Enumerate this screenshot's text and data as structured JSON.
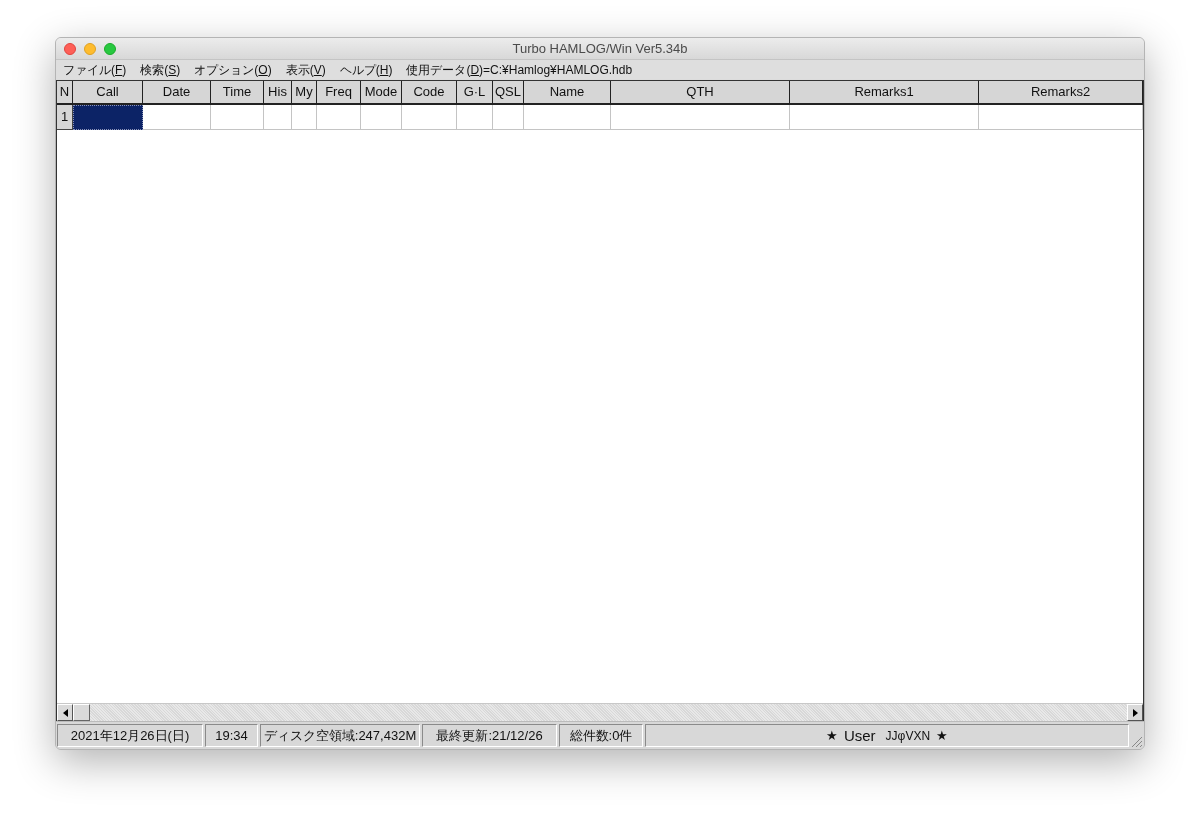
{
  "window": {
    "title": "Turbo HAMLOG/Win Ver5.34b"
  },
  "menu": [
    {
      "label": "ファイル(",
      "key": "F",
      "suffix": ")"
    },
    {
      "label": "検索(",
      "key": "S",
      "suffix": ")"
    },
    {
      "label": "オプション(",
      "key": "O",
      "suffix": ")"
    },
    {
      "label": "表示(",
      "key": "V",
      "suffix": ")"
    },
    {
      "label": "ヘルプ(",
      "key": "H",
      "suffix": ")"
    },
    {
      "label": "使用データ(",
      "key": "D",
      "suffix": ")=C:¥Hamlog¥HAMLOG.hdb"
    }
  ],
  "table": {
    "columns": [
      "N",
      "Call",
      "Date",
      "Time",
      "His",
      "My",
      "Freq",
      "Mode",
      "Code",
      "G·L",
      "QSL",
      "Name",
      "QTH",
      "Remarks1",
      "Remarks2"
    ],
    "rows": [
      {
        "number": "1",
        "cells": [
          {
            "selected": true
          },
          {
            "selected": false
          },
          {
            "selected": false
          },
          {
            "selected": false
          },
          {
            "selected": false
          },
          {
            "selected": false
          },
          {
            "selected": false
          },
          {
            "selected": false
          },
          {
            "selected": false
          },
          {
            "selected": false
          },
          {
            "selected": false
          },
          {
            "selected": false
          },
          {
            "selected": false
          },
          {
            "selected": false
          }
        ]
      }
    ]
  },
  "status_bar": [
    {
      "kind": "text",
      "text": "2021年12月26日(日)"
    },
    {
      "kind": "text",
      "text": "19:34"
    },
    {
      "kind": "text",
      "text": "ディスク空領域:247,432M"
    },
    {
      "kind": "text",
      "text": "最終更新:21/12/26"
    },
    {
      "kind": "text",
      "text": "総件数:0件"
    },
    {
      "kind": "user",
      "star_left": "★",
      "label": "User",
      "callsign": "JJφVXN",
      "star_right": "★"
    }
  ]
}
